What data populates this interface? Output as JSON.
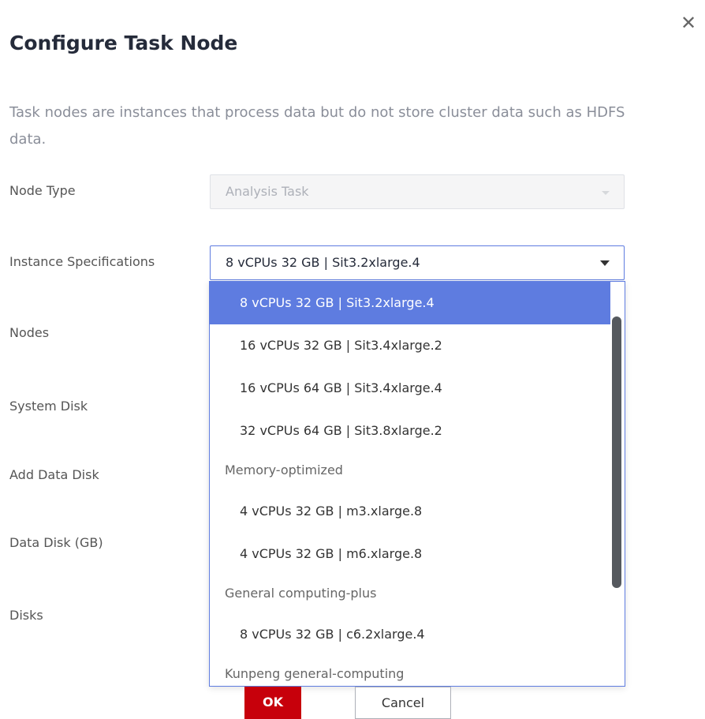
{
  "dialog": {
    "close_icon": "close-icon",
    "title": "Configure Task Node",
    "description": "Task nodes are instances that process data but do not store cluster data such as HDFS data."
  },
  "form": {
    "labels": {
      "node_type": "Node Type",
      "instance_spec": "Instance Specifications",
      "nodes": "Nodes",
      "system_disk": "System Disk",
      "add_data_disk": "Add Data Disk",
      "data_disk": "Data Disk (GB)",
      "disks": "Disks"
    },
    "node_type_value": "Analysis Task",
    "instance_spec_value": "8 vCPUs 32 GB | Sit3.2xlarge.4"
  },
  "dropdown": {
    "items": [
      {
        "label": "8 vCPUs 32 GB | Sit3.2xlarge.4"
      },
      {
        "label": "16 vCPUs 32 GB | Sit3.4xlarge.2"
      },
      {
        "label": "16 vCPUs 64 GB | Sit3.4xlarge.4"
      },
      {
        "label": "32 vCPUs 64 GB | Sit3.8xlarge.2"
      },
      {
        "group": "Memory-optimized"
      },
      {
        "label": "4 vCPUs 32 GB | m3.xlarge.8"
      },
      {
        "label": "4 vCPUs 32 GB | m6.xlarge.8"
      },
      {
        "group": "General computing-plus"
      },
      {
        "label": "8 vCPUs 32 GB | c6.2xlarge.4"
      },
      {
        "group": "Kunpeng general-computing"
      }
    ]
  },
  "buttons": {
    "ok": "OK",
    "cancel": "Cancel"
  },
  "colors": {
    "accent": "#5e7ce0",
    "ok_button": "#c7000b"
  }
}
